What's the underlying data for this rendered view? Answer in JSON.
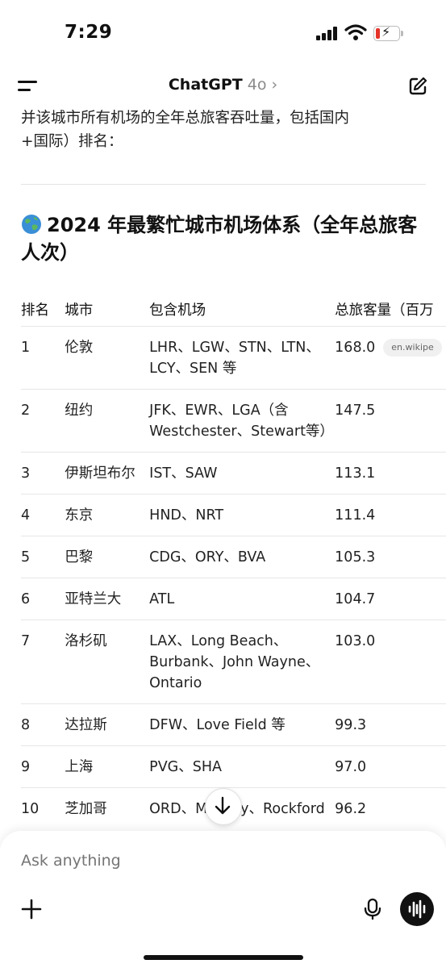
{
  "status_bar": {
    "time": "7:29"
  },
  "nav": {
    "app_name": "ChatGPT",
    "model": "4o",
    "chevron": "›"
  },
  "message": {
    "intro_line1": "并该城市所有机场的全年总旅客吞吐量，包括国内",
    "intro_line2": "+国际）排名：",
    "heading": "2024 年最繁忙城市机场体系（全年总旅客人次）",
    "heading_icon": "globe-emoji",
    "table": {
      "headers": [
        "排名",
        "城市",
        "包含机场",
        "总旅客量（百万"
      ],
      "rows": [
        {
          "rank": "1",
          "city": "伦敦",
          "airports": "LHR、LGW、STN、LTN、LCY、SEN 等",
          "total": "168.0",
          "cite": "en.wikipe"
        },
        {
          "rank": "2",
          "city": "纽约",
          "airports": "JFK、EWR、LGA（含 Westchester、Stewart等）",
          "total": "147.5"
        },
        {
          "rank": "3",
          "city": "伊斯坦布尔",
          "airports": "IST、SAW",
          "total": "113.1"
        },
        {
          "rank": "4",
          "city": "东京",
          "airports": "HND、NRT",
          "total": "111.4"
        },
        {
          "rank": "5",
          "city": "巴黎",
          "airports": "CDG、ORY、BVA",
          "total": "105.3"
        },
        {
          "rank": "6",
          "city": "亚特兰大",
          "airports": "ATL",
          "total": "104.7"
        },
        {
          "rank": "7",
          "city": "洛杉矶",
          "airports": "LAX、Long Beach、Burbank、John Wayne、Ontario",
          "total": "103.0"
        },
        {
          "rank": "8",
          "city": "达拉斯",
          "airports": "DFW、Love Field 等",
          "total": "99.3"
        },
        {
          "rank": "9",
          "city": "上海",
          "airports": "PVG、SHA",
          "total": "97.0"
        },
        {
          "rank": "10",
          "city": "芝加哥",
          "airports": "ORD、Midway、Rockford",
          "total": "96.2"
        }
      ]
    }
  },
  "composer": {
    "placeholder": "Ask anything"
  },
  "colors": {
    "accent": "#111111",
    "muted": "#8a8a8a",
    "battery_low": "#e5332a"
  }
}
